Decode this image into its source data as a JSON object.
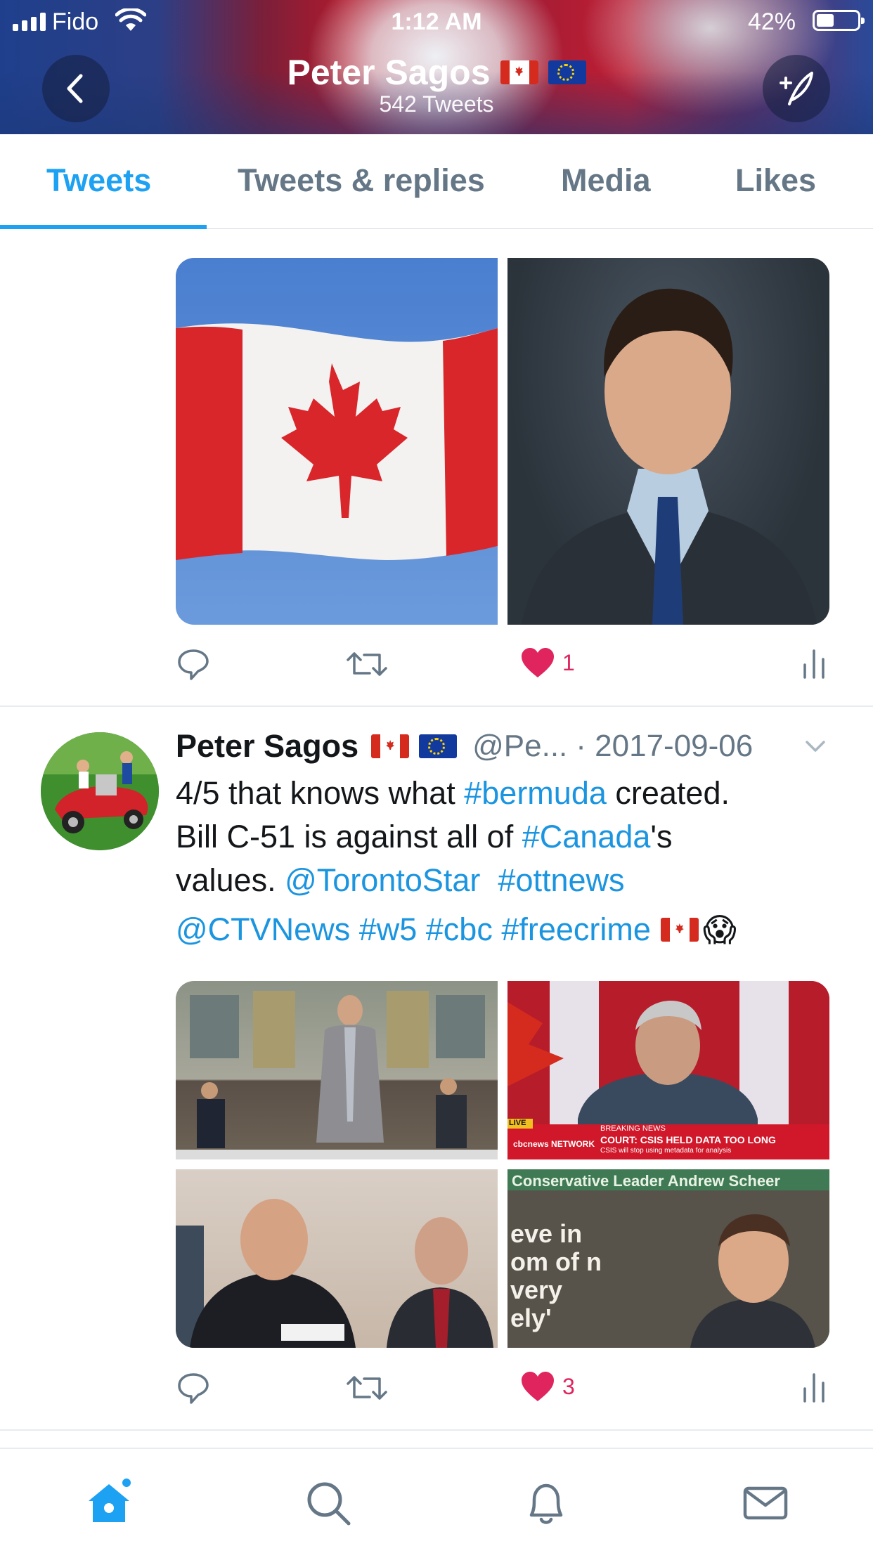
{
  "status_bar": {
    "carrier": "Fido",
    "time": "1:12 AM",
    "battery": "42%",
    "battery_level": 0.42,
    "icons": [
      "signal-icon",
      "wifi-icon",
      "battery-icon"
    ]
  },
  "header": {
    "name": "Peter Sagos",
    "tweet_count": "542 Tweets",
    "flags": [
      "flag-canada-icon",
      "flag-eu-icon"
    ],
    "back_icon": "chevron-left-icon",
    "compose_icon": "compose-tweet-icon"
  },
  "tabs": [
    {
      "label": "Tweets",
      "active": true
    },
    {
      "label": "Tweets & replies",
      "active": false
    },
    {
      "label": "Media",
      "active": false
    },
    {
      "label": "Likes",
      "active": false
    }
  ],
  "tweets": [
    {
      "media": [
        "canada-flag-photo",
        "justin-trudeau-portrait-photo"
      ],
      "actions": {
        "reply": "",
        "retweet": "",
        "likes": "1",
        "liked": true
      }
    },
    {
      "author": "Peter Sagos",
      "handle": "@Pe...",
      "date": "· 2017-09-06",
      "text": {
        "l1_a": "4/5 that knows what ",
        "l1_link": "#bermuda",
        "l1_b": " created.",
        "l2_a": "Bill C-51 is against all of ",
        "l2_link": "#Canada",
        "l2_b": "'s",
        "l3_a": "values. ",
        "l3_link1": "@TorontoStar",
        "l3_link2": "#ottnews",
        "l4_link": "@CTVNews #w5 #cbc #freecrime",
        "emoji": "😱"
      },
      "media": [
        "parliament-hallway-photo",
        "cbc-news-broadcast-screenshot",
        "rcmp-committee-photo",
        "andrew-scheer-newspaper-photo"
      ],
      "media_text": {
        "breaking": "BREAKING NEWS",
        "headline": "COURT: CSIS HELD DATA TOO LONG",
        "subline": "CSIS will stop using metadata for analysis",
        "live": "LIVE",
        "network": "cbcnews NETWORK",
        "scheer_banner": "Conservative Leader Andrew Scheer",
        "scheer_quote": "eve in om of n very ely'"
      },
      "actions": {
        "reply": "",
        "retweet": "",
        "likes": "3",
        "liked": true
      }
    }
  ],
  "tabbar": {
    "items": [
      "home-icon",
      "search-icon",
      "notifications-icon",
      "messages-icon"
    ],
    "active": "home-icon",
    "accent": "#1da1f2"
  },
  "colors": {
    "accent": "#1da1f2",
    "like": "#e0245e",
    "text": "#14171a",
    "secondary": "#657786"
  }
}
